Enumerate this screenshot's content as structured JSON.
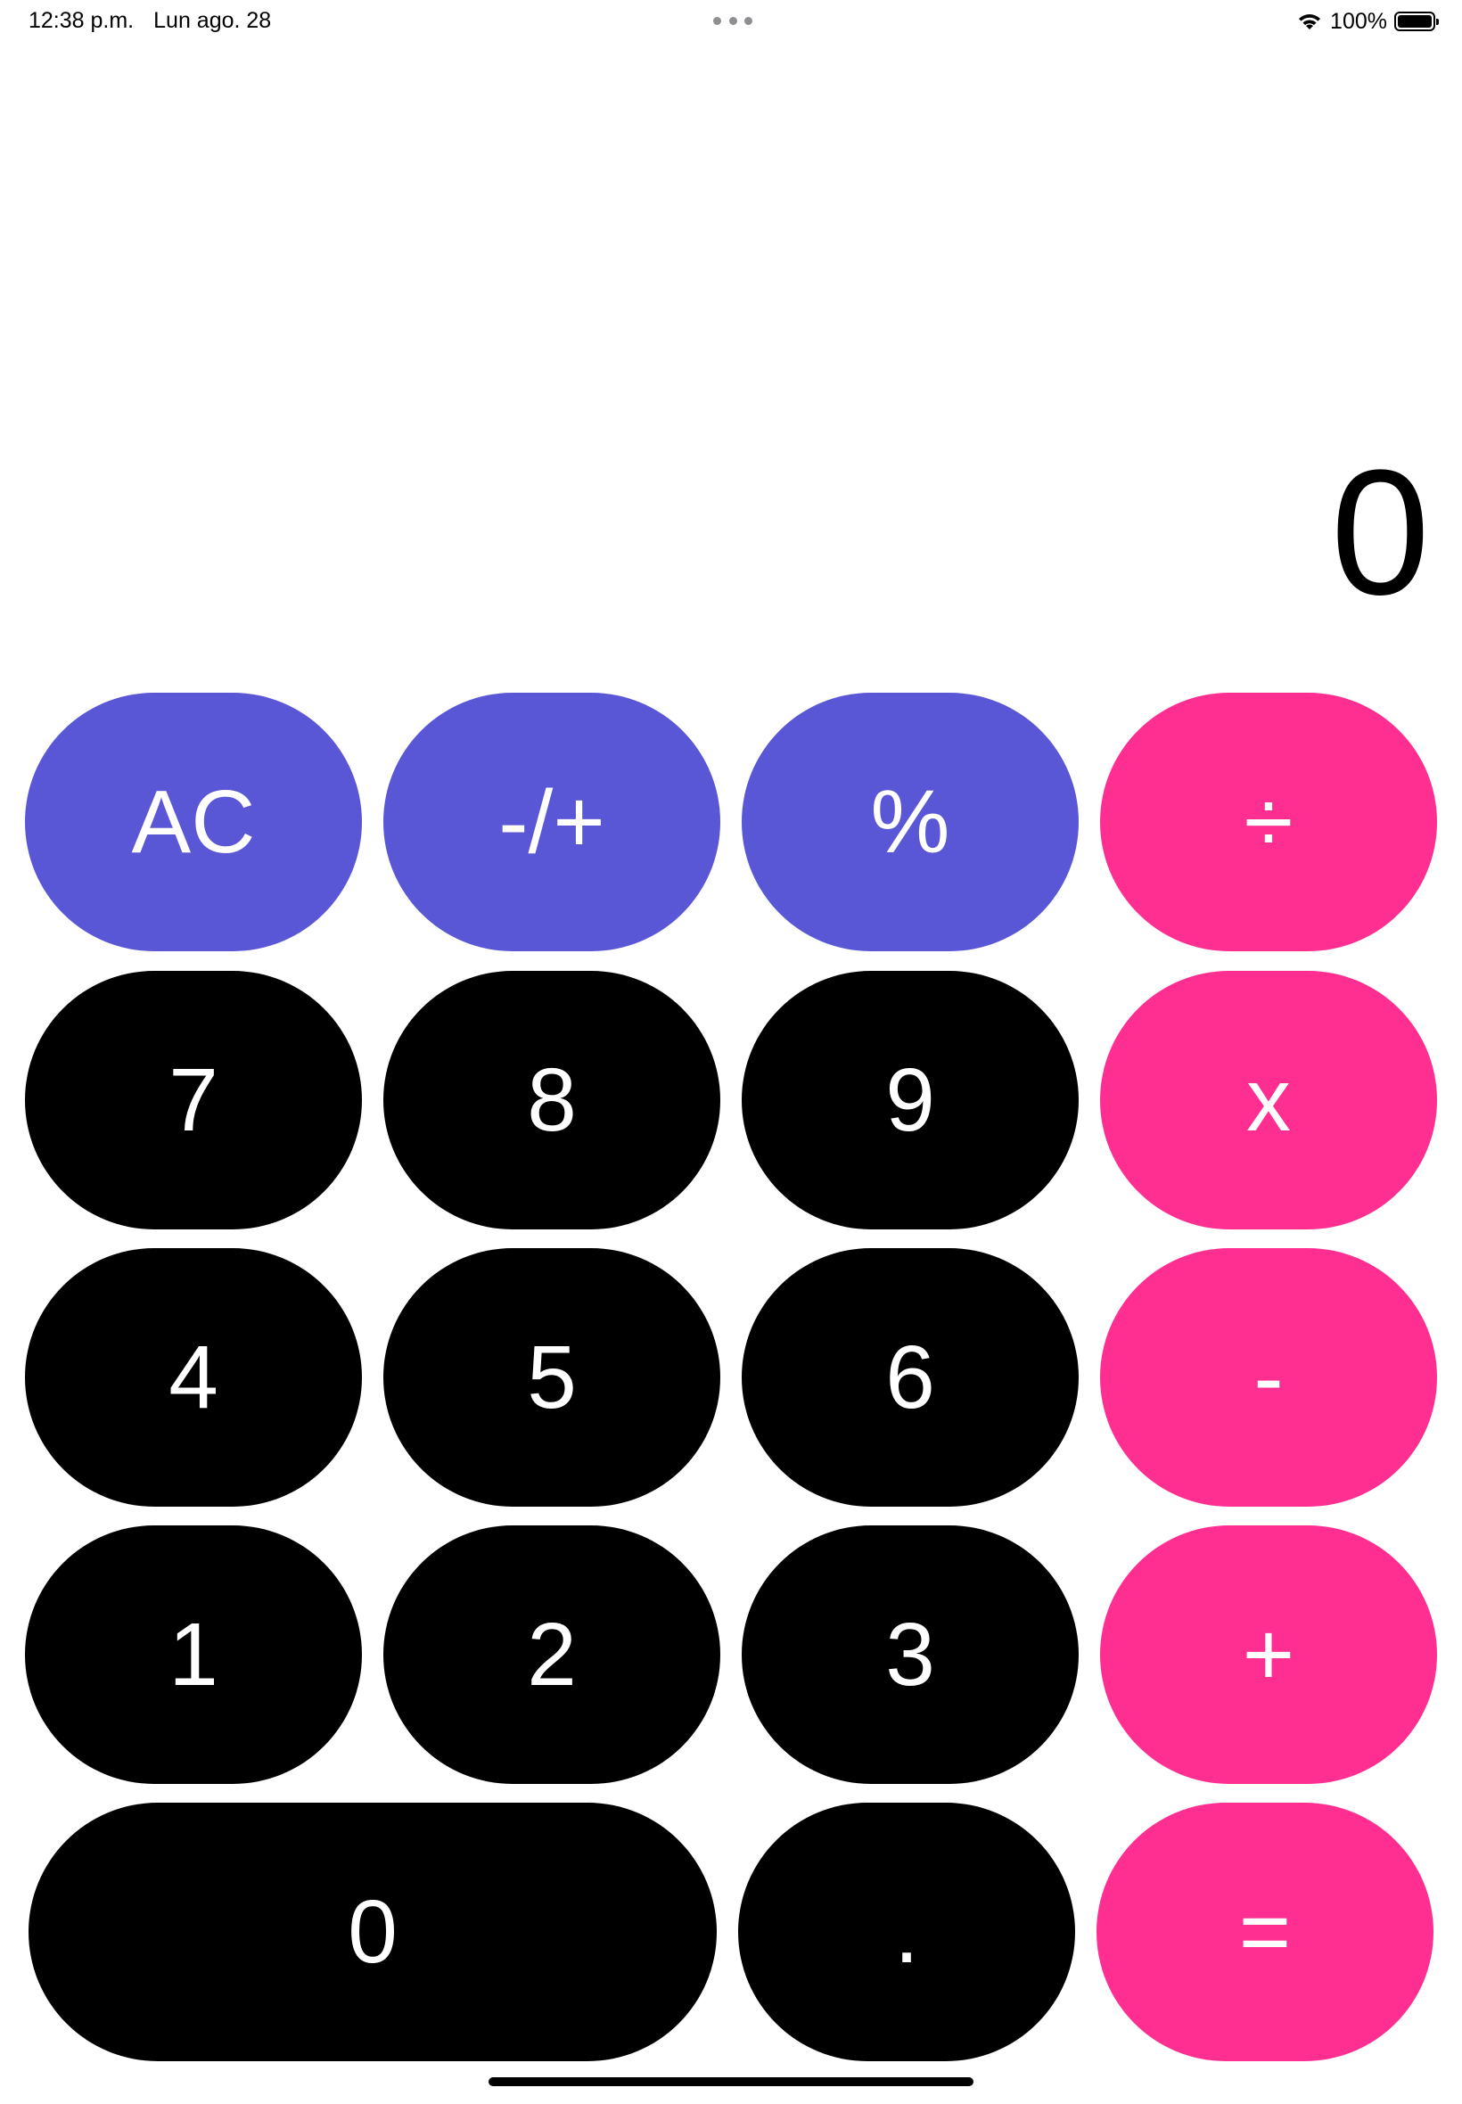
{
  "status_bar": {
    "time": "12:38 p.m.",
    "date": "Lun ago. 28",
    "battery_percent": "100%",
    "wifi_icon": "wifi-icon",
    "battery_icon": "battery-icon",
    "battery_level": 1.0
  },
  "display": {
    "value": "0"
  },
  "keys": {
    "row1": [
      "AC",
      "-/+",
      "%",
      "÷"
    ],
    "row2": [
      "7",
      "8",
      "9",
      "x"
    ],
    "row3": [
      "4",
      "5",
      "6",
      "-"
    ],
    "row4": [
      "1",
      "2",
      "3",
      "+"
    ],
    "row5": [
      "0",
      ".",
      "="
    ]
  },
  "colors": {
    "function_keys": "#5a57d6",
    "operator_keys": "#ff2f92",
    "number_keys": "#000000",
    "background": "#ffffff"
  }
}
